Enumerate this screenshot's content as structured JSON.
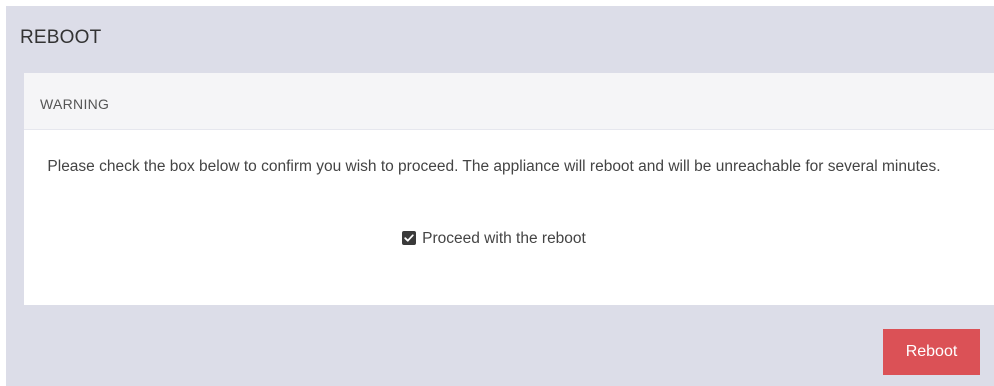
{
  "panel": {
    "title": "REBOOT"
  },
  "warning": {
    "header": "WARNING",
    "message": "Please check the box below to confirm you wish to proceed. The appliance will reboot and will be unreachable for several minutes.",
    "confirm_label": "Proceed with the reboot",
    "confirm_checked": true
  },
  "actions": {
    "reboot_label": "Reboot"
  },
  "colors": {
    "panel_background": "#dcdde8",
    "card_background": "#ffffff",
    "card_header_background": "#f5f5f7",
    "reboot_button": "#db5156"
  },
  "icons": {
    "confirm_checkbox": "checkbox-checked-icon"
  }
}
